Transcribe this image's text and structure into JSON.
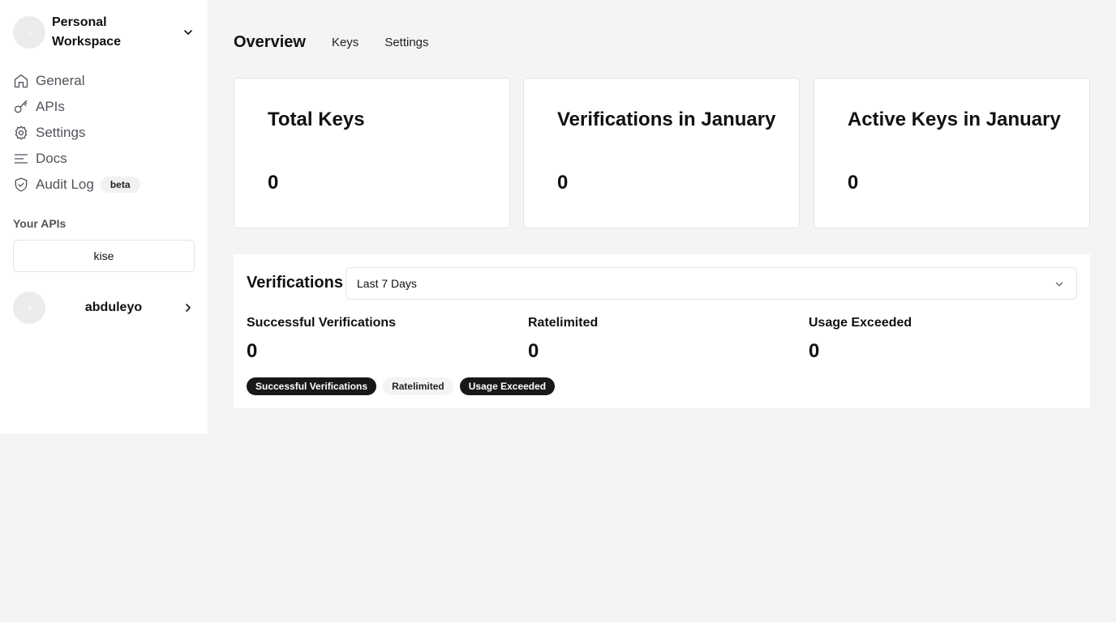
{
  "workspace": {
    "name": "Personal Workspace",
    "icon": "chevron-down-icon"
  },
  "nav": {
    "items": [
      {
        "label": "General",
        "icon": "home-icon"
      },
      {
        "label": "APIs",
        "icon": "key-icon"
      },
      {
        "label": "Settings",
        "icon": "gear-icon"
      },
      {
        "label": "Docs",
        "icon": "text-lines-icon"
      },
      {
        "label": "Audit Log",
        "icon": "shield-check-icon",
        "badge": "beta"
      }
    ]
  },
  "your_apis": {
    "title": "Your APIs",
    "items": [
      "kise"
    ]
  },
  "user": {
    "name": "abduleyo",
    "icon": "chevron-right-icon"
  },
  "tabs": {
    "overview": "Overview",
    "keys": "Keys",
    "settings": "Settings"
  },
  "cards": [
    {
      "title": "Total Keys",
      "value": "0"
    },
    {
      "title": "Verifications in January",
      "value": "0"
    },
    {
      "title": "Active Keys in January",
      "value": "0"
    }
  ],
  "verifications": {
    "title": "Verifications",
    "range": {
      "selected": "Last 7 Days"
    },
    "stats": [
      {
        "label": "Successful Verifications",
        "value": "0"
      },
      {
        "label": "Ratelimited",
        "value": "0"
      },
      {
        "label": "Usage Exceeded",
        "value": "0"
      }
    ],
    "legend": [
      {
        "label": "Successful Verifications",
        "active": true
      },
      {
        "label": "Ratelimited",
        "active": false
      },
      {
        "label": "Usage Exceeded",
        "active": true
      }
    ]
  },
  "colors": {
    "background": "#f3f4f6",
    "surface": "#ffffff",
    "pill_dark": "#18181b",
    "muted_text": "#52525b"
  }
}
